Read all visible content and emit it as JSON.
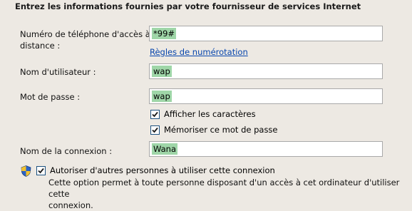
{
  "header": {
    "title": "Entrez les informations fournies par votre fournisseur de services Internet"
  },
  "phone": {
    "label_line1": "Numéro de téléphone d'accès à",
    "label_line2": "distance :",
    "value": "*99#",
    "dialing_rules_link": "Règles de numérotation"
  },
  "username": {
    "label": "Nom d'utilisateur :",
    "value": "wap"
  },
  "password": {
    "label": "Mot de passe :",
    "value": "wap",
    "show_characters": {
      "label": "Afficher les caractères",
      "checked": true
    },
    "remember": {
      "label": "Mémoriser ce mot de passe",
      "checked": true
    }
  },
  "connection": {
    "label": "Nom de la connexion :",
    "value": "Wana"
  },
  "share": {
    "label": "Autoriser d'autres personnes à utiliser cette connexion",
    "checked": true,
    "description_line1": "Cette option permet à toute personne disposant d'un accès à cet ordinateur d'utiliser cette",
    "description_line2": "connexion.",
    "icon": "uac-shield-icon"
  },
  "colors": {
    "background": "#ede9e3",
    "link": "#0645ad",
    "value_highlight": "#9fd6a8",
    "checkbox_border": "#1c5180"
  }
}
